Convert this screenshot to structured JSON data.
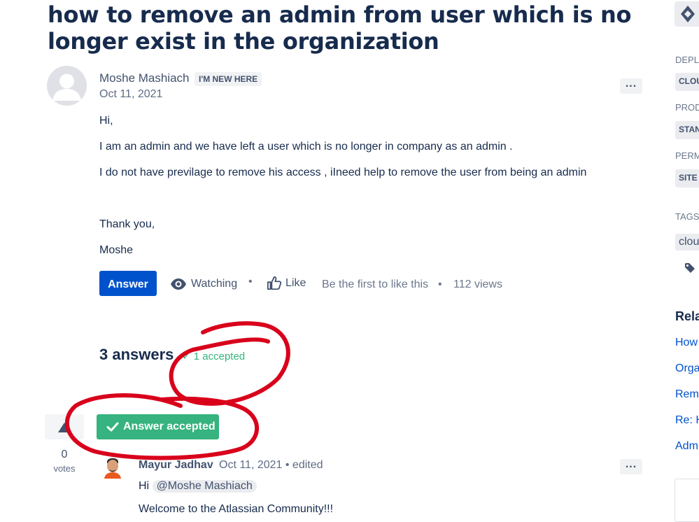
{
  "question": {
    "title": "how to remove an admin from user which is no longer exist in the organization",
    "author": "Moshe Mashiach",
    "badge": "I'M NEW HERE",
    "date": "Oct 11, 2021",
    "more": "...",
    "body": [
      "Hi,",
      "I am an admin and we have left a user which is no longer in company as an admin .",
      "I do not have previlage to remove his access , iIneed help to remove the user from being an admin",
      "Thank you,",
      "Moshe"
    ],
    "actions": {
      "answer_label": "Answer",
      "watching_label": "Watching",
      "like_label": "Like",
      "first_like": "Be the first to like this",
      "views": "112 views"
    }
  },
  "answers": {
    "count_label": "3 answers",
    "accepted_label": "1 accepted"
  },
  "accepted_answer": {
    "status_label": "Answer accepted",
    "votes": "0",
    "votes_label": "votes",
    "author": "Mayur Jadhav",
    "meta": "Oct 11, 2021 • edited",
    "greeting": "Hi",
    "mention": "@Moshe Mashiach",
    "welcome": "Welcome to the Atlassian Community!!!",
    "more": "..."
  },
  "sidebar": {
    "deployment_label": "DEPLO",
    "deployment_value": "CLOU",
    "product_label": "PROD",
    "product_value": "STAN",
    "permissions_label": "PERM",
    "permissions_value": "SITE",
    "tags_label": "TAGS",
    "tag": "clou",
    "related_label": "Rela",
    "related_links": [
      "How",
      "Orga",
      "Remo",
      "Re: H",
      "Adm"
    ]
  },
  "colors": {
    "primary": "#0052cc",
    "accepted": "#36b37e",
    "annotation": "#d9001b"
  },
  "icons": [
    "user-avatar-icon",
    "watch-eye-icon",
    "like-thumb-icon",
    "check-icon",
    "upvote-triangle-icon",
    "tag-icon",
    "jira-diamond-icon"
  ]
}
